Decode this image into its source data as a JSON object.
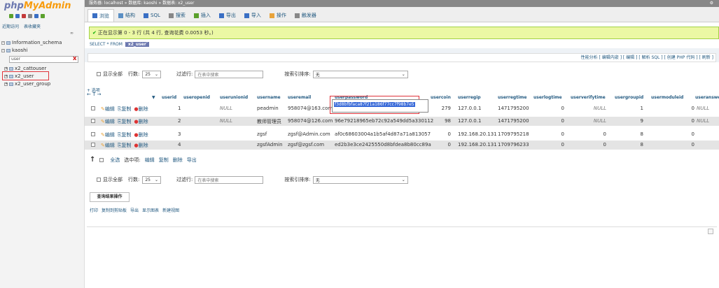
{
  "sidebar": {
    "logo_php": "php",
    "logo_my": "MyAdmin",
    "icon_colors": [
      "#5aa02c",
      "#3a6fc4",
      "#c43a3a",
      "#888888",
      "#3a6fc4",
      "#5aa02c"
    ],
    "links": [
      "近期访问",
      "表收藏夹"
    ],
    "collapse": "∞",
    "tree": [
      {
        "pm": "-",
        "label": "Information_schema"
      },
      {
        "pm": "-",
        "label": "kaoshi"
      },
      {
        "pm": "+",
        "label": "x2_cattouser"
      },
      {
        "pm": "+",
        "label": "x2_user"
      },
      {
        "pm": "+",
        "label": "x2_user_group"
      }
    ],
    "filter_value": "user",
    "filter_clear": "X"
  },
  "topbar": {
    "path": "服务器: localhost » 数据库: kaoshi » 数据表: x2_user",
    "gear": "⚙"
  },
  "tabs": [
    {
      "label": "浏览",
      "icon_color": "#3a6fc4"
    },
    {
      "label": "结构",
      "icon_color": "#5a8fc4"
    },
    {
      "label": "SQL",
      "icon_color": "#3a6fc4"
    },
    {
      "label": "搜索",
      "icon_color": "#888888"
    },
    {
      "label": "插入",
      "icon_color": "#5aa02c"
    },
    {
      "label": "导出",
      "icon_color": "#3a6fc4"
    },
    {
      "label": "导入",
      "icon_color": "#3a6fc4"
    },
    {
      "label": "操作",
      "icon_color": "#e8a33a"
    },
    {
      "label": "触发器",
      "icon_color": "#888888"
    }
  ],
  "success": {
    "check": "✔",
    "text": "正在显示第 0 - 3 行 (共 4 行, 查询花费 0.0053 秒。)"
  },
  "crumb": {
    "a": "SELECT",
    "b": "* FROM",
    "c": "`x2_user`"
  },
  "links_bar": "性能分析 [ 编辑内嵌 ] [ 编辑 ] [ 解析 SQL ] [ 创建 PHP 代码 ] [ 刷新 ]",
  "nav": {
    "show_all": "显示全部",
    "rows_label": "行数:",
    "rows_value": "25",
    "filter_label": "过滤行:",
    "search_placeholder": "在表中搜索",
    "sort_label": "按索引排序:",
    "sort_value": "无",
    "caret": "⌄"
  },
  "options_label": "+ 选项",
  "arrows": "← T →",
  "columns": [
    {
      "label": "userid",
      "sorted": "▼"
    },
    {
      "label": "useropenid"
    },
    {
      "label": "userunionid"
    },
    {
      "label": "username"
    },
    {
      "label": "useremail"
    },
    {
      "label": "userpassword"
    },
    {
      "label": "usercoin"
    },
    {
      "label": "userregip"
    },
    {
      "label": "userregtime"
    },
    {
      "label": "userlogtime"
    },
    {
      "label": "userverifytime"
    },
    {
      "label": "usergroupid"
    },
    {
      "label": "usermoduleid"
    },
    {
      "label": "useranswe"
    }
  ],
  "actions": {
    "edit": "编辑",
    "copy": "复制",
    "delete": "删除"
  },
  "rows": [
    {
      "userid": "1",
      "useropenid": "NULL",
      "username": "peadmin",
      "useremail": "958074@163.com",
      "userpassword": "",
      "usercoin": "279",
      "userregip": "127.0.0.1",
      "userregtime": "1471795200",
      "userlogtime": "0",
      "userverifytime": "NULL",
      "usergroupid": "1",
      "usermoduleid": "0",
      "useranswe": "NULL"
    },
    {
      "userid": "2",
      "useropenid": "NULL",
      "username": "教师管理员",
      "useremail": "958074@126.com",
      "userpassword": "96e79218965eb72c92a549dd5a330112",
      "usercoin": "98",
      "userregip": "127.0.0.1",
      "userregtime": "1471795200",
      "userlogtime": "0",
      "userverifytime": "NULL",
      "usergroupid": "9",
      "usermoduleid": "0",
      "useranswe": "NULL"
    },
    {
      "userid": "3",
      "useropenid": "",
      "username": "zgsf",
      "useremail": "zgsf@Admin.com",
      "userpassword": "af0c68603004a1b5af4d87a71a813057",
      "usercoin": "0",
      "userregip": "192.168.20.131",
      "userregtime": "1709795218",
      "userlogtime": "0",
      "userverifytime": "0",
      "usergroupid": "8",
      "usermoduleid": "0",
      "useranswe": ""
    },
    {
      "userid": "4",
      "useropenid": "",
      "username": "zgsfAdmin",
      "useremail": "zgsf@zgsf.com",
      "userpassword": "ed2b3e3ce2425550d8bfdea8b80cc89a",
      "usercoin": "0",
      "userregip": "192.168.20.131",
      "userregtime": "1709796233",
      "userlogtime": "0",
      "userverifytime": "0",
      "usergroupid": "8",
      "usermoduleid": "0",
      "useranswe": ""
    }
  ],
  "editing_password": "f3d8bfbfaca87f21a186f77cc7f98b7e5",
  "bulk": {
    "up": "↑",
    "select_all": "全选",
    "selected": "选中项:",
    "edit": "编辑",
    "copy": "复制",
    "delete": "删除",
    "export": "导出"
  },
  "query_ops": {
    "legend": "查询结果操作",
    "items": [
      "打印",
      "复制到剪贴板",
      "导出",
      "显示图表",
      "新建视图"
    ]
  }
}
